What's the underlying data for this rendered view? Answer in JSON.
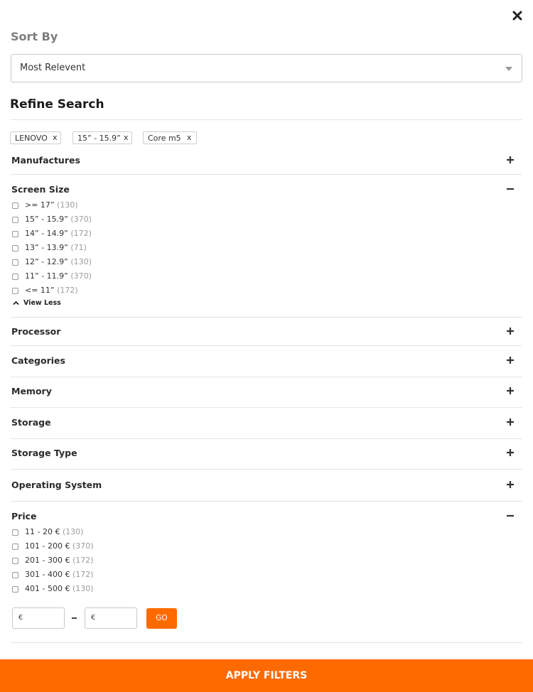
{
  "header": {
    "close_icon": "close-icon"
  },
  "sort": {
    "label": "Sort By",
    "selected": "Most Relevent"
  },
  "refine": {
    "title": "Refine Search",
    "chips": [
      {
        "label": "LENOVO",
        "remove": "x"
      },
      {
        "label": "15” - 15.9”",
        "remove": "x"
      },
      {
        "label": "Core m5",
        "remove": "x"
      }
    ]
  },
  "sections": {
    "manufactures": {
      "title": "Manufactures",
      "state": "collapsed"
    },
    "screen_size": {
      "title": "Screen Size",
      "state": "expanded",
      "options": [
        {
          "label": ">= 17”",
          "count": "(130)"
        },
        {
          "label": "15” - 15.9”",
          "count": "(370)"
        },
        {
          "label": "14” - 14.9”",
          "count": "(172)"
        },
        {
          "label": "13” - 13.9”",
          "count": "(71)"
        },
        {
          "label": "12” - 12.9”",
          "count": "(130)"
        },
        {
          "label": "11” - 11.9”",
          "count": "(370)"
        },
        {
          "label": "<= 11”",
          "count": "(172)"
        }
      ],
      "view_less": "View Less"
    },
    "processor": {
      "title": "Processor",
      "state": "collapsed"
    },
    "categories": {
      "title": "Categories",
      "state": "collapsed"
    },
    "memory": {
      "title": "Memory",
      "state": "collapsed"
    },
    "storage": {
      "title": "Storage",
      "state": "collapsed"
    },
    "storage_type": {
      "title": "Storage Type",
      "state": "collapsed"
    },
    "operating_system": {
      "title": "Operating System",
      "state": "collapsed"
    },
    "price": {
      "title": "Price",
      "state": "expanded",
      "options": [
        {
          "label": "11 - 20 €",
          "count": "(130)"
        },
        {
          "label": "101 - 200 €",
          "count": "(370)"
        },
        {
          "label": "201 - 300 €",
          "count": "(172)"
        },
        {
          "label": "301 - 400 €",
          "count": "(172)"
        },
        {
          "label": "401 - 500 €",
          "count": "(130)"
        }
      ],
      "min_placeholder": "€",
      "max_placeholder": "€",
      "go_label": "GO"
    }
  },
  "footer": {
    "apply_label": "APPLY FILTERS"
  },
  "colors": {
    "accent": "#ff6a00",
    "count": "#9b9b9b",
    "divider": "#e4e4e4"
  }
}
